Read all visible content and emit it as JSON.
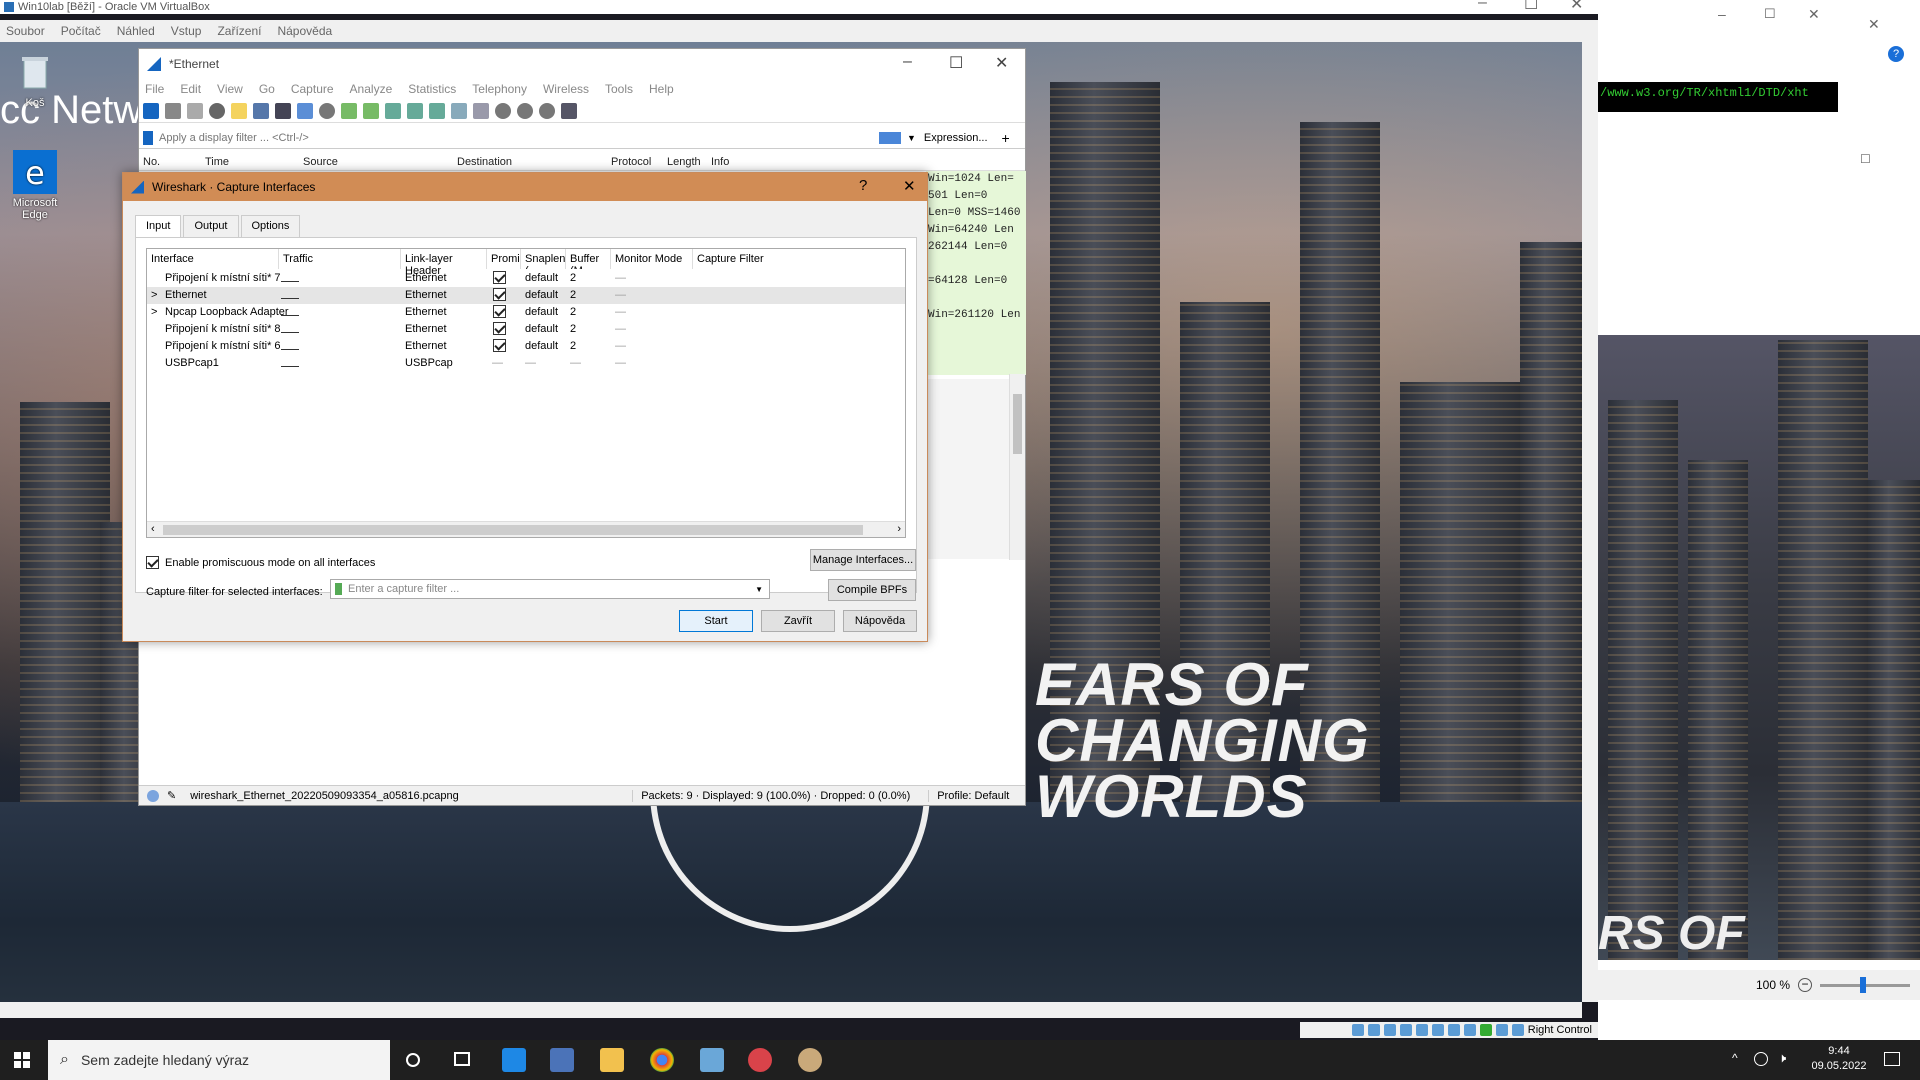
{
  "vbox": {
    "title": "Win10lab [Běží] - Oracle VM VirtualBox",
    "menu": [
      "Soubor",
      "Počítač",
      "Náhled",
      "Vstup",
      "Zařízení",
      "Nápověda"
    ],
    "status_right": "Right Control"
  },
  "desktop": {
    "icons": [
      {
        "label": "Koš",
        "icon": "recycle-bin-icon"
      },
      {
        "label": "Microsoft Edge",
        "icon": "edge-icon"
      }
    ],
    "bg_text_lines": [
      "EARS OF",
      "CHANGING",
      "WORLDS"
    ],
    "partial_text": "cc Netw"
  },
  "wireshark": {
    "title": "*Ethernet",
    "menu": [
      "File",
      "Edit",
      "View",
      "Go",
      "Capture",
      "Analyze",
      "Statistics",
      "Telephony",
      "Wireless",
      "Tools",
      "Help"
    ],
    "filter_placeholder": "Apply a display filter ... <Ctrl-/>",
    "expression_label": "Expression...",
    "plus_label": "+",
    "columns": [
      "No.",
      "Time",
      "Source",
      "Destination",
      "Protocol",
      "Length",
      "Info"
    ],
    "packet_info_fragments": [
      " Win=1024 Len=",
      "501 Len=0",
      "Len=0 MSS=1460",
      " Win=64240 Len",
      "262144 Len=0",
      "",
      "=64128 Len=0",
      "",
      "Win=261120 Len"
    ],
    "status_file": "wireshark_Ethernet_20220509093354_a05816.pcapng",
    "status_packets": "Packets: 9 · Displayed: 9 (100.0%) · Dropped: 0 (0.0%)",
    "status_profile": "Profile: Default"
  },
  "dialog": {
    "title": "Wireshark · Capture Interfaces",
    "help_label": "?",
    "tabs": [
      "Input",
      "Output",
      "Options"
    ],
    "headers": [
      "Interface",
      "Traffic",
      "Link-layer Header",
      "Promis",
      "Snaplen (",
      "Buffer (M",
      "Monitor Mode",
      "Capture Filter"
    ],
    "rows": [
      {
        "expander": "",
        "name": "Připojení k místní síti* 7",
        "link": "Ethernet",
        "promisc": true,
        "snaplen": "default",
        "buffer": "2",
        "monitor": "—"
      },
      {
        "expander": ">",
        "name": "Ethernet",
        "link": "Ethernet",
        "promisc": true,
        "snaplen": "default",
        "buffer": "2",
        "monitor": "—"
      },
      {
        "expander": ">",
        "name": "Npcap Loopback Adapter",
        "link": "Ethernet",
        "promisc": true,
        "snaplen": "default",
        "buffer": "2",
        "monitor": "—"
      },
      {
        "expander": "",
        "name": "Připojení k místní síti* 8",
        "link": "Ethernet",
        "promisc": true,
        "snaplen": "default",
        "buffer": "2",
        "monitor": "—"
      },
      {
        "expander": "",
        "name": "Připojení k místní síti* 6",
        "link": "Ethernet",
        "promisc": true,
        "snaplen": "default",
        "buffer": "2",
        "monitor": "—"
      },
      {
        "expander": "",
        "name": "USBPcap1",
        "link": "USBPcap",
        "promisc": null,
        "snaplen": "—",
        "buffer": "—",
        "monitor": "—"
      }
    ],
    "selected_row": 1,
    "promisc_all_label": "Enable promiscuous mode on all interfaces",
    "promisc_all": true,
    "manage_label": "Manage Interfaces...",
    "capture_filter_label": "Capture filter for selected interfaces:",
    "capture_filter_placeholder": "Enter a capture filter ...",
    "compile_label": "Compile BPFs",
    "start_label": "Start",
    "close_label": "Zavřít",
    "help_button_label": "Nápověda"
  },
  "right": {
    "code_text": "/www.w3.org/TR/xhtml1/DTD/xht",
    "zoom": "100 %",
    "partial_text": "RS OF"
  },
  "taskbar": {
    "search_placeholder": "Sem zadejte hledaný výraz",
    "time": "9:44",
    "date": "09.05.2022"
  },
  "colors": {
    "dialog_title": "#d18c55",
    "accent": "#0078d7",
    "taskbar": "#1f1f1f"
  }
}
